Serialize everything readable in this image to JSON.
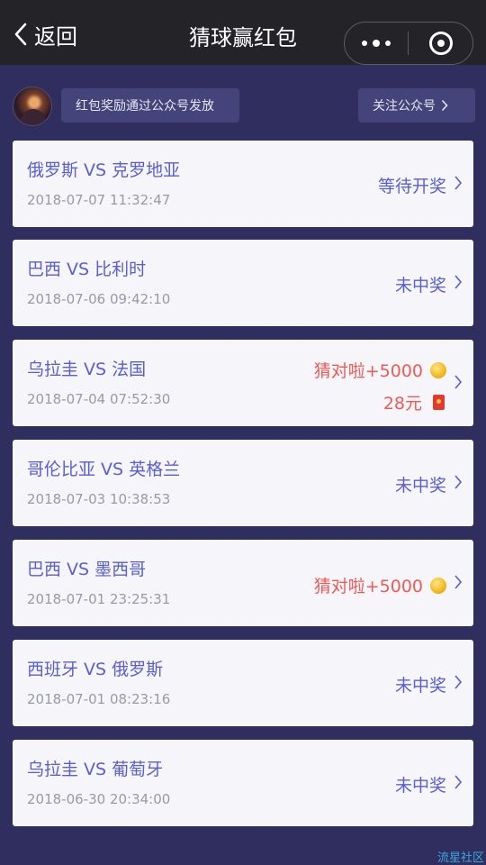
{
  "topbar": {
    "back_label": "返回",
    "title": "猜球赢红包"
  },
  "info": {
    "notice": "红包奖励通过公众号发放",
    "follow_label": "关注公众号"
  },
  "records": [
    {
      "match": "俄罗斯 VS 克罗地亚",
      "time": "2018-07-07 11:32:47",
      "status": "等待开奖"
    },
    {
      "match": "巴西 VS 比利时",
      "time": "2018-07-06 09:42:10",
      "status": "未中奖"
    },
    {
      "match": "乌拉圭 VS 法国",
      "time": "2018-07-04 07:52:30",
      "win": "猜对啦+5000",
      "prize": "28元"
    },
    {
      "match": "哥伦比亚 VS 英格兰",
      "time": "2018-07-03 10:38:53",
      "status": "未中奖"
    },
    {
      "match": "巴西 VS 墨西哥",
      "time": "2018-07-01 23:25:31",
      "win": "猜对啦+5000"
    },
    {
      "match": "西班牙 VS 俄罗斯",
      "time": "2018-07-01 08:23:16",
      "status": "未中奖"
    },
    {
      "match": "乌拉圭 VS 葡萄牙",
      "time": "2018-06-30 20:34:00",
      "status": "未中奖"
    }
  ],
  "icons": {
    "back": "chevron-left-icon",
    "more": "more-dots-icon",
    "close": "close-circle-icon",
    "chevron": "chevron-right-icon",
    "coin": "gold-coin-icon",
    "red_packet": "red-packet-icon"
  },
  "colors": {
    "background": "#2f2e5f",
    "topbar": "#232328",
    "match_text": "#5a5ed4",
    "win_text": "#f05a55",
    "card": "#f5f5fa"
  },
  "watermark": "流星社区"
}
